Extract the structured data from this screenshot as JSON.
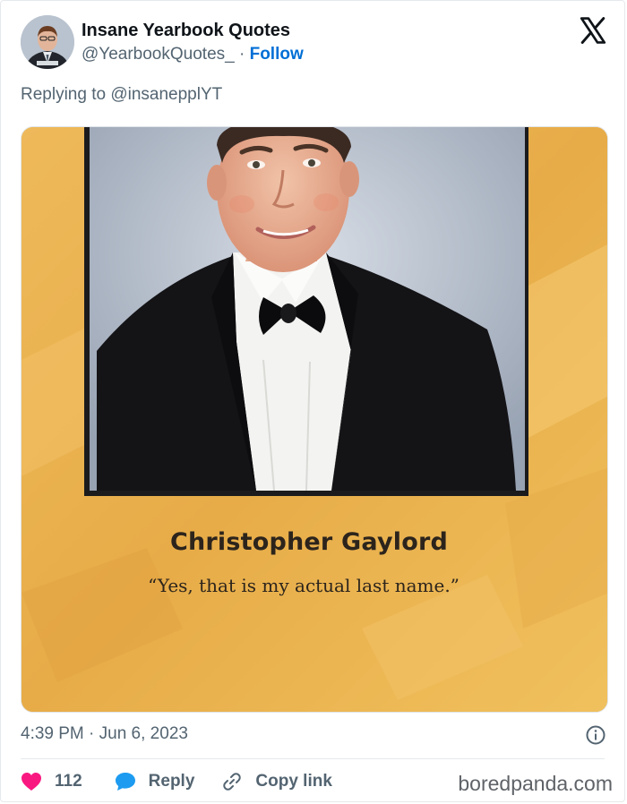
{
  "tweet": {
    "author_name": "Insane Yearbook Quotes",
    "handle": "@YearbookQuotes_",
    "separator": "·",
    "follow_label": "Follow",
    "replying_prefix": "Replying to",
    "replying_to": "@insanepplYT",
    "timestamp": "4:39 PM · Jun 6, 2023",
    "likes": "112",
    "reply_label": "Reply",
    "copy_link_label": "Copy link"
  },
  "media": {
    "yearbook_name": "Christopher Gaylord",
    "yearbook_quote": "“Yes, that is my actual last name.”"
  },
  "watermark": "boredpanda.com",
  "colors": {
    "like": "#f91880",
    "reply": "#1d9bf0",
    "follow": "#006fd6",
    "muted": "#536471",
    "yearbook_page": "#e8b24a"
  },
  "icons": [
    "x-logo-icon",
    "info-icon",
    "heart-icon",
    "reply-bubble-icon",
    "link-icon"
  ]
}
